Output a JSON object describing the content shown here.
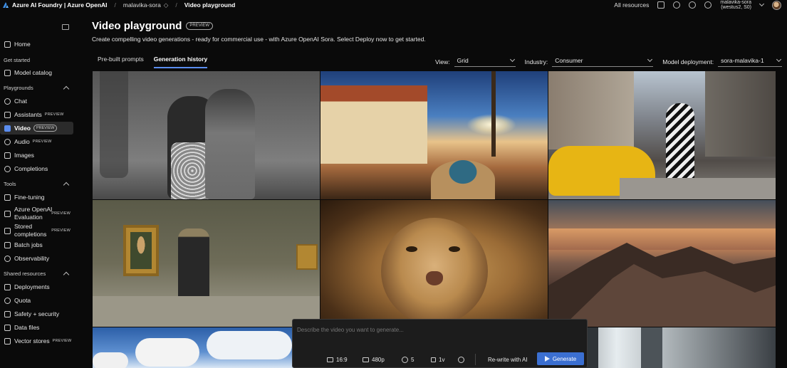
{
  "topbar": {
    "brand": "Azure AI Foundry | Azure OpenAI",
    "project": "malavika-sora",
    "current_page": "Video playground",
    "all_resources": "All resources",
    "account_name": "malavika-sora",
    "account_region": "(westus2, S0)"
  },
  "sidebar": {
    "home": "Home",
    "get_started": "Get started",
    "model_catalog": "Model catalog",
    "playgrounds": "Playgrounds",
    "chat": "Chat",
    "assistants": "Assistants",
    "assistants_tag": "PREVIEW",
    "video": "Video",
    "video_tag": "PREVIEW",
    "audio": "Audio",
    "audio_tag": "PREVIEW",
    "images": "Images",
    "completions": "Completions",
    "tools": "Tools",
    "fine_tuning": "Fine-tuning",
    "evaluation_line1": "Azure OpenAI",
    "evaluation_line2": "Evaluation",
    "evaluation_tag": "PREVIEW",
    "stored_line1": "Stored",
    "stored_line2": "completions",
    "stored_tag": "PREVIEW",
    "batch_jobs": "Batch jobs",
    "observability": "Observability",
    "shared_resources": "Shared resources",
    "deployments": "Deployments",
    "quota": "Quota",
    "safety": "Safety + security",
    "data_files": "Data files",
    "vector_stores": "Vector stores",
    "vector_stores_tag": "PREVIEW"
  },
  "main": {
    "title": "Video playground",
    "title_tag": "PREVIEW",
    "subtitle": "Create compelling video generations - ready for commercial use - with Azure OpenAI Sora. Select Deploy now to get started.",
    "tabs": [
      "Pre-built prompts",
      "Generation history"
    ],
    "view_label": "View:",
    "view_value": "Grid",
    "industry_label": "Industry:",
    "industry_value": "Consumer",
    "deployment_label": "Model deployment:",
    "deployment_value": "sora-malavika-1"
  },
  "prompt": {
    "placeholder": "Describe the video you want to generate...",
    "aspect": "16:9",
    "resolution": "480p",
    "duration": "5",
    "variants": "1v",
    "rewrite": "Re-write with AI",
    "generate": "Generate"
  }
}
